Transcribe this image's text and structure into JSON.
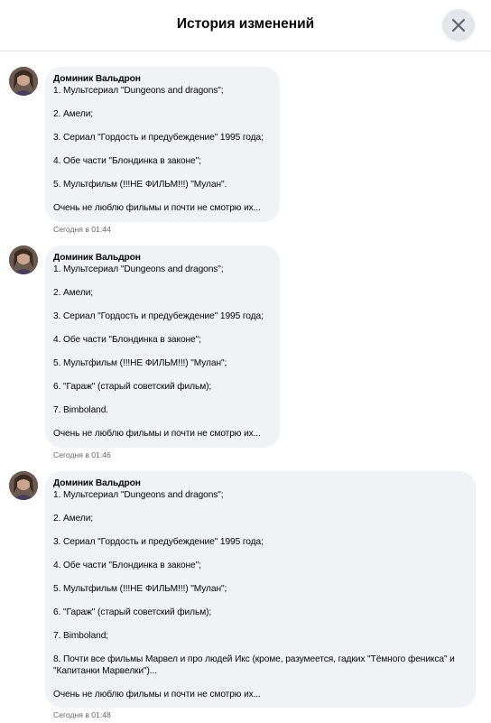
{
  "header": {
    "title": "История изменений",
    "close_icon": "close-icon"
  },
  "entries": [
    {
      "author": "Доминик Вальдрон",
      "lines": [
        "1. Мультсериал \"Dungeons and dragons\";",
        "2. Амели;",
        "3. Сериал \"Гордость и предубеждение\" 1995 года;",
        "4. Обе части \"Блондинка в законе\";",
        "5. Мультфильм (!!!НЕ ФИЛЬМ!!!) \"Мулан\".",
        "Очень не люблю фильмы и почти не смотрю их..."
      ],
      "timestamp": "Сегодня в 01:44"
    },
    {
      "author": "Доминик Вальдрон",
      "lines": [
        "1. Мультсериал \"Dungeons and dragons\";",
        "2. Амели;",
        "3. Сериал \"Гордость и предубеждение\" 1995 года;",
        "4. Обе части \"Блондинка в законе\";",
        "5. Мультфильм (!!!НЕ ФИЛЬМ!!!) \"Мулан\";",
        "6. \"Гараж\" (старый советский фильм);",
        "7. Bimboland.",
        "Очень не люблю фильмы и почти не смотрю их..."
      ],
      "timestamp": "Сегодня в 01:46"
    },
    {
      "author": "Доминик Вальдрон",
      "lines": [
        "1. Мультсериал \"Dungeons and dragons\";",
        "2. Амели;",
        "3. Сериал \"Гордость и предубеждение\" 1995 года;",
        "4. Обе части \"Блондинка в законе\";",
        "5. Мультфильм (!!!НЕ ФИЛЬМ!!!) \"Мулан\";",
        "6. \"Гараж\" (старый советский фильм);",
        "7. Bimboland;",
        "8. Почти все фильмы Марвел и про людей Икс (кроме, разумеется, гадких \"Тёмного феникса\" и \"Капитанки Марвелки\")...",
        "Очень не люблю фильмы и почти не смотрю их..."
      ],
      "timestamp": "Сегодня в 01:48"
    }
  ],
  "colors": {
    "bubble_bg": "#f0f2f5",
    "timestamp": "#65676b",
    "divider": "#e4e6eb"
  }
}
